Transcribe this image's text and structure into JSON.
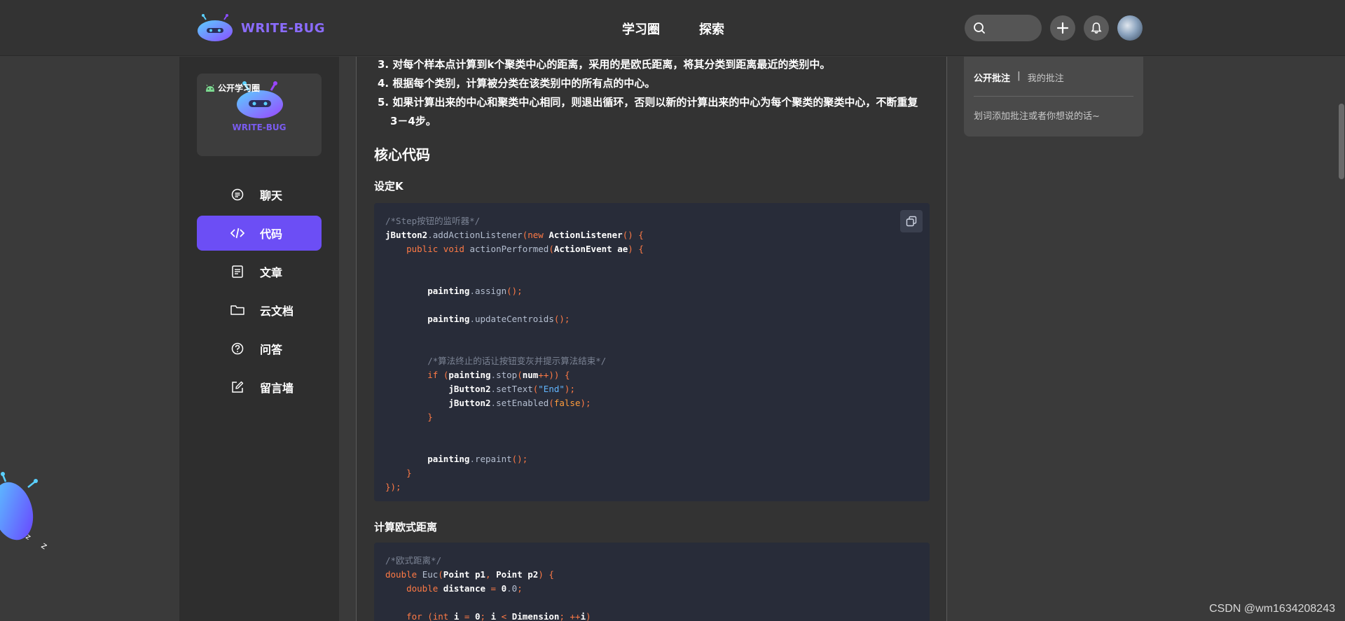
{
  "brand": {
    "name": "WRITE-BUG"
  },
  "topnav": {
    "items": [
      "学习圈",
      "探索"
    ]
  },
  "sidebar": {
    "circle_card": {
      "tag": "公开学习圈",
      "brand": "WRITE-BUG"
    },
    "items": [
      {
        "label": "聊天",
        "icon": "chat-icon"
      },
      {
        "label": "代码",
        "icon": "code-icon",
        "active": true
      },
      {
        "label": "文章",
        "icon": "article-icon"
      },
      {
        "label": "云文档",
        "icon": "folder-icon"
      },
      {
        "label": "问答",
        "icon": "question-icon"
      },
      {
        "label": "留言墙",
        "icon": "edit-icon"
      }
    ]
  },
  "content": {
    "steps": [
      "3. 对每个样本点计算到k个聚类中心的距离，采用的是欧氏距离，将其分类到距离最近的类别中。",
      "4. 根据每个类别，计算被分类在该类别中的所有点的中心。",
      "5. 如果计算出来的中心和聚类中心相同，则退出循环，否则以新的计算出来的中心为每个聚类的聚类中心，不断重复3－4步。"
    ],
    "h2": "核心代码",
    "section1_title": "设定K",
    "section2_title": "计算欧式距离"
  },
  "right_panel": {
    "tab_public": "公开批注",
    "separator": "|",
    "tab_mine": "我的批注",
    "hint": "划词添加批注或者你想说的话~"
  },
  "watermark": "CSDN @wm1634208243",
  "colors": {
    "accent": "#6c4ef5",
    "code_bg": "#282c39",
    "keyword": "#ff7a45"
  }
}
